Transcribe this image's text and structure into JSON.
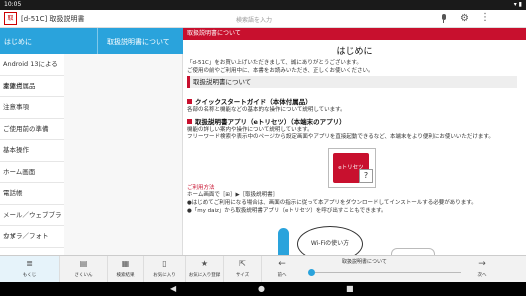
{
  "status": {
    "time": "10:05",
    "right": "▾ ▮"
  },
  "appbar": {
    "icon_text": "取",
    "title": "[d-51C] 取扱説明書",
    "search_placeholder": "検索語を入力",
    "mic_icon": "mic-icon",
    "gear_icon": "⚙",
    "more_icon": "⋮"
  },
  "toc": {
    "home_label": "はじめに",
    "current_label": "取扱説明書について",
    "items": [
      "Android 13による変更点",
      "本体付属品",
      "注意事項",
      "ご使用前の準備",
      "基本操作",
      "ホーム画面",
      "電話帳",
      "メール／ウェブブラウザ",
      "カメラ／フォト"
    ]
  },
  "content": {
    "banner": "取扱説明書について",
    "title": "はじめに",
    "intro1": "「d-51C」をお買い上げいただきまして、誠にありがとうございます。",
    "intro2": "ご使用の前やご利用中に、本書をお読みいただき、正しくお使いください。",
    "section": "取扱説明書について",
    "qs_title": "クイックスタートガイド（本体付属品）",
    "qs_body": "各部の名称と機能などの基本的な操作について説明しています。",
    "app_title": "取扱説明書アプリ（eトリセツ）（本端末のアプリ）",
    "app_body1": "機能の詳しい案内や操作について説明しています。",
    "app_body2": "フリーワード検索や表示中のページから設定画面やアプリを直接起動できるなど、本端末をより便利にお使いいただけます。",
    "image_label": "eトリセツ",
    "image_q": "?",
    "usage_title": "ご利用方法",
    "usage1": "ホーム画面で［⊞］▶［取扱説明書］",
    "usage2": "●はじめてご利用になる場合は、画面の指示に従って本アプリをダウンロードしてインストールする必要があります。",
    "usage3": "●「my daiz」から取扱説明書アプリ（eトリセツ）を呼び出すこともできます。",
    "bubble": "Wi-Fiの使い方"
  },
  "toolbar": {
    "buttons": [
      {
        "label": "もくじ",
        "icon": "≣"
      },
      {
        "label": "さくいん",
        "icon": "▤"
      },
      {
        "label": "検索結果",
        "icon": "▦"
      },
      {
        "label": "お気に入り",
        "icon": "▯"
      },
      {
        "label": "お気に入り登録",
        "icon": "★"
      },
      {
        "label": "サイズ",
        "icon": "⇱"
      }
    ],
    "prev_label": "前へ",
    "prev_icon": "←",
    "next_label": "次へ",
    "next_icon": "→",
    "page_label": "取扱説明書について",
    "progress": 0.0
  },
  "navbar": {
    "back": "◀",
    "home": "●",
    "recent": "■"
  }
}
